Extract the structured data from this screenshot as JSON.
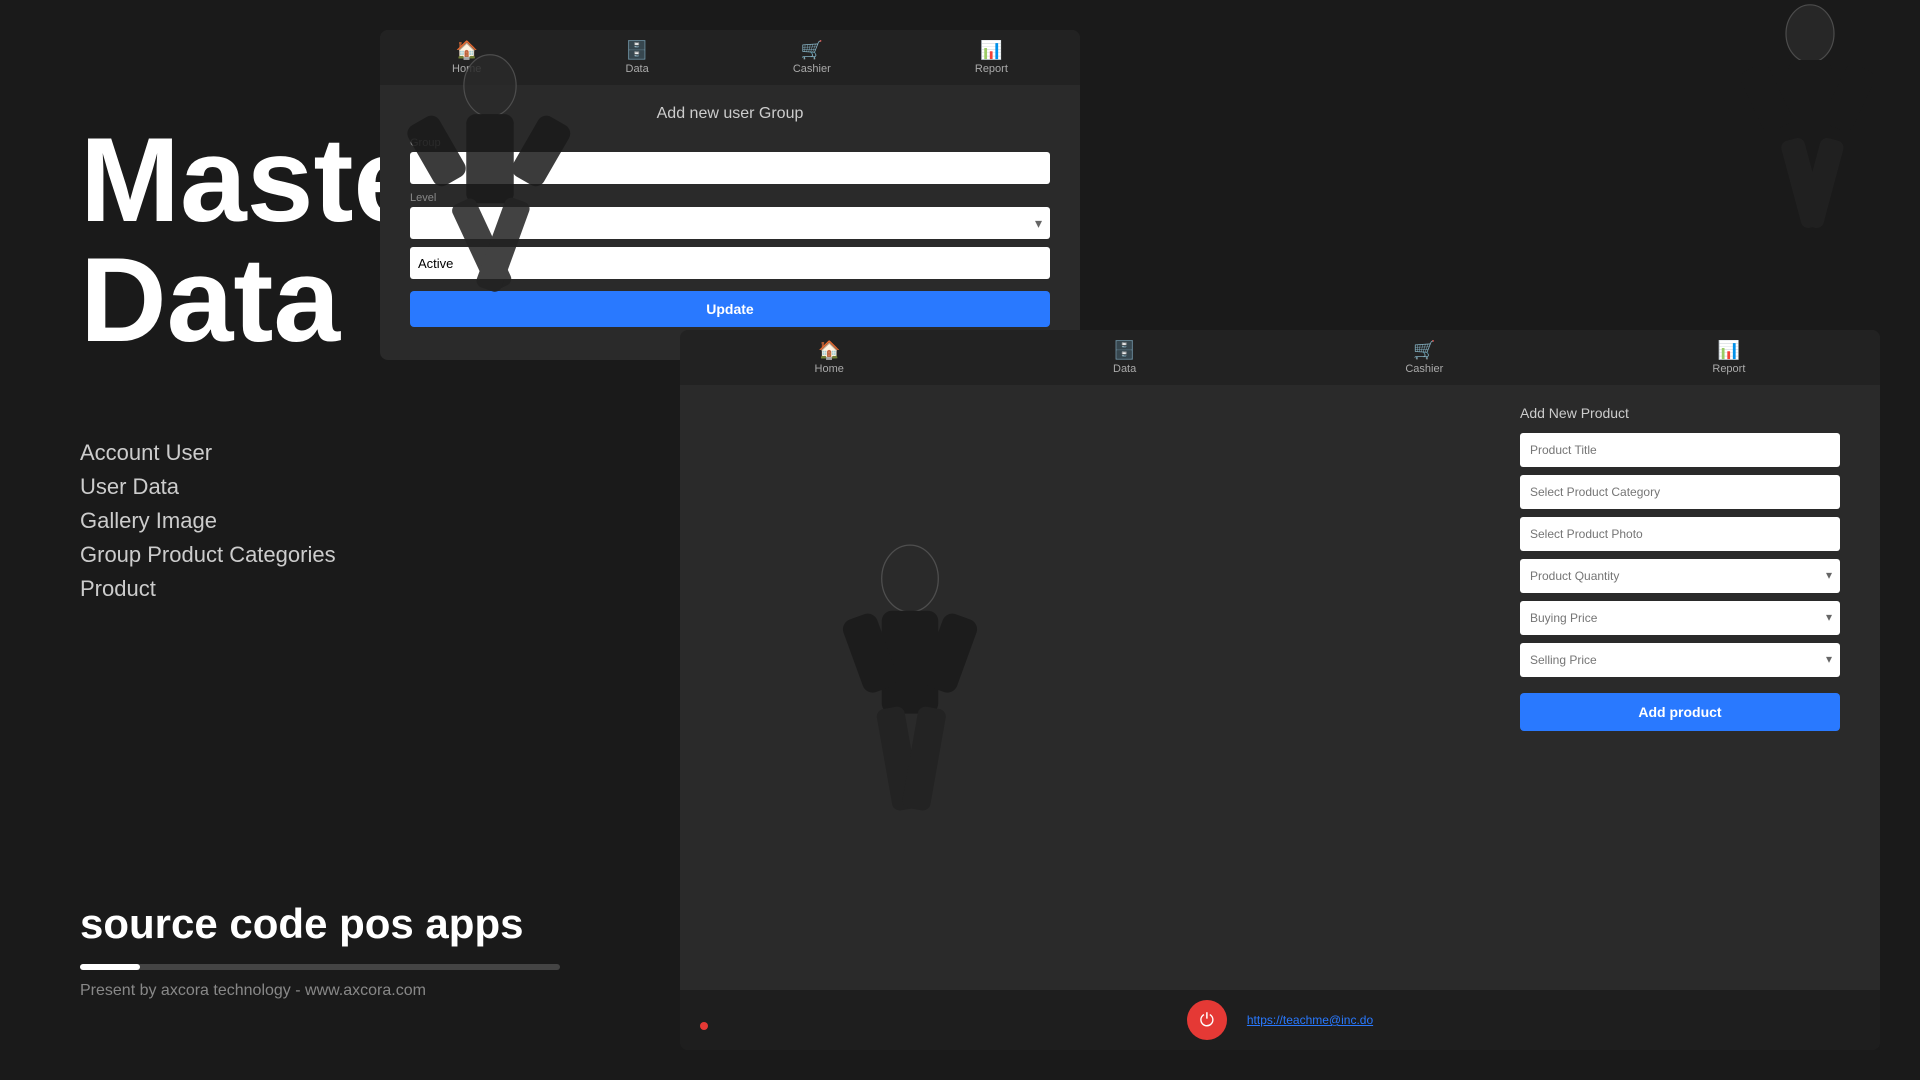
{
  "left": {
    "title_line1": "Master",
    "title_line2": "Data",
    "nav_items": [
      {
        "label": "Account User"
      },
      {
        "label": "User Data"
      },
      {
        "label": "Gallery Image"
      },
      {
        "label": "Group Product Categories"
      },
      {
        "label": "Product"
      }
    ],
    "source_code_text": "source code pos apps",
    "present_text": "Present by axcora technology - www.axcora.com",
    "progress_percent": 12
  },
  "top_form": {
    "navbar": [
      {
        "icon": "🏠",
        "label": "Home"
      },
      {
        "icon": "🗄️",
        "label": "Data"
      },
      {
        "icon": "🛒",
        "label": "Cashier"
      },
      {
        "icon": "📊",
        "label": "Report"
      }
    ],
    "title": "Add new user Group",
    "fields": [
      {
        "label": "Group",
        "placeholder": "",
        "type": "text",
        "has_icon": false
      },
      {
        "label": "Level",
        "placeholder": "",
        "type": "text",
        "has_icon": true
      },
      {
        "label": "",
        "placeholder": "Active",
        "type": "text",
        "has_icon": false
      }
    ],
    "update_button": "Update"
  },
  "bottom_form": {
    "navbar": [
      {
        "icon": "🏠",
        "label": "Home"
      },
      {
        "icon": "🗄️",
        "label": "Data"
      },
      {
        "icon": "🛒",
        "label": "Cashier"
      },
      {
        "icon": "📊",
        "label": "Report"
      }
    ],
    "title": "Add New Product",
    "fields": [
      {
        "placeholder": "Product Title",
        "has_icon": false
      },
      {
        "placeholder": "Select Product Category",
        "has_icon": false
      },
      {
        "placeholder": "Select Product Photo",
        "has_icon": false
      },
      {
        "placeholder": "Product Quantity",
        "has_icon": true
      },
      {
        "placeholder": "Buying Price",
        "has_icon": true
      },
      {
        "placeholder": "Selling Price",
        "has_icon": true
      }
    ],
    "add_button": "Add product",
    "power_link": "https://teachme@inc.do"
  },
  "colors": {
    "accent_blue": "#2979ff",
    "background_dark": "#1a1a1a",
    "form_background": "#2a2a2a",
    "power_red": "#e53935"
  }
}
